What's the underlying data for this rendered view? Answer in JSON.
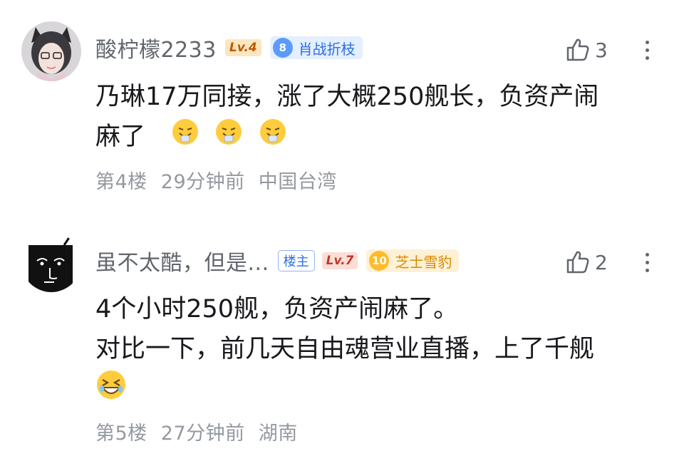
{
  "comments": [
    {
      "username": "酸柠檬2233",
      "level": "Lv.4",
      "fan_badge_level": "8",
      "fan_badge_name": "肖战折枝",
      "likes": "3",
      "line1": "乃琳17万同接，涨了大概250舰长，负资产闹",
      "line2": "麻了",
      "floor": "第4楼",
      "time": "29分钟前",
      "location": "中国台湾",
      "emoji_icon": "sneezing-face-icon"
    },
    {
      "username": "虽不太酷，但是...",
      "owner_tag": "楼主",
      "level": "Lv.7",
      "fan_badge_level": "10",
      "fan_badge_name": "芝士雪豹",
      "likes": "2",
      "line1": "4个小时250舰，负资产闹麻了。",
      "line2": "对比一下，前几天自由魂营业直播，上了千舰",
      "floor": "第5楼",
      "time": "27分钟前",
      "location": "湖南",
      "emoji_icon": "laughing-face-icon"
    }
  ],
  "colors": {
    "meta": "#9499a0",
    "username": "#61666d",
    "text": "#18191c"
  }
}
